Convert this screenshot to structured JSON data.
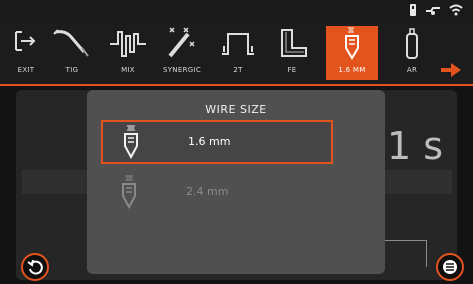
{
  "toolbar": {
    "items": [
      {
        "label": "EXIT",
        "icon": "exit-icon"
      },
      {
        "label": "TIG",
        "icon": "tig-torch-icon"
      },
      {
        "label": "MIX",
        "icon": "mix-icon"
      },
      {
        "label": "SYNERGIC",
        "icon": "synergic-icon"
      },
      {
        "label": "2T",
        "icon": "2t-trigger-icon"
      },
      {
        "label": "FE",
        "icon": "fe-material-icon"
      },
      {
        "label": "1.6 MM",
        "icon": "wire-spool-icon",
        "active": true
      },
      {
        "label": "AR",
        "icon": "gas-cylinder-icon"
      }
    ],
    "next_icon": "arrow-right-icon"
  },
  "background": {
    "time_value": "1 s"
  },
  "modal": {
    "title": "WIRE SIZE",
    "options": [
      {
        "label": "1.6 mm",
        "selected": true
      },
      {
        "label": "2.4 mm",
        "selected": false
      }
    ]
  },
  "footer": {
    "left_icon": "back-icon",
    "right_icon": "menu-icon"
  },
  "colors": {
    "accent": "#e2531e",
    "modal_bg": "#505050",
    "screen_bg": "#131313"
  }
}
